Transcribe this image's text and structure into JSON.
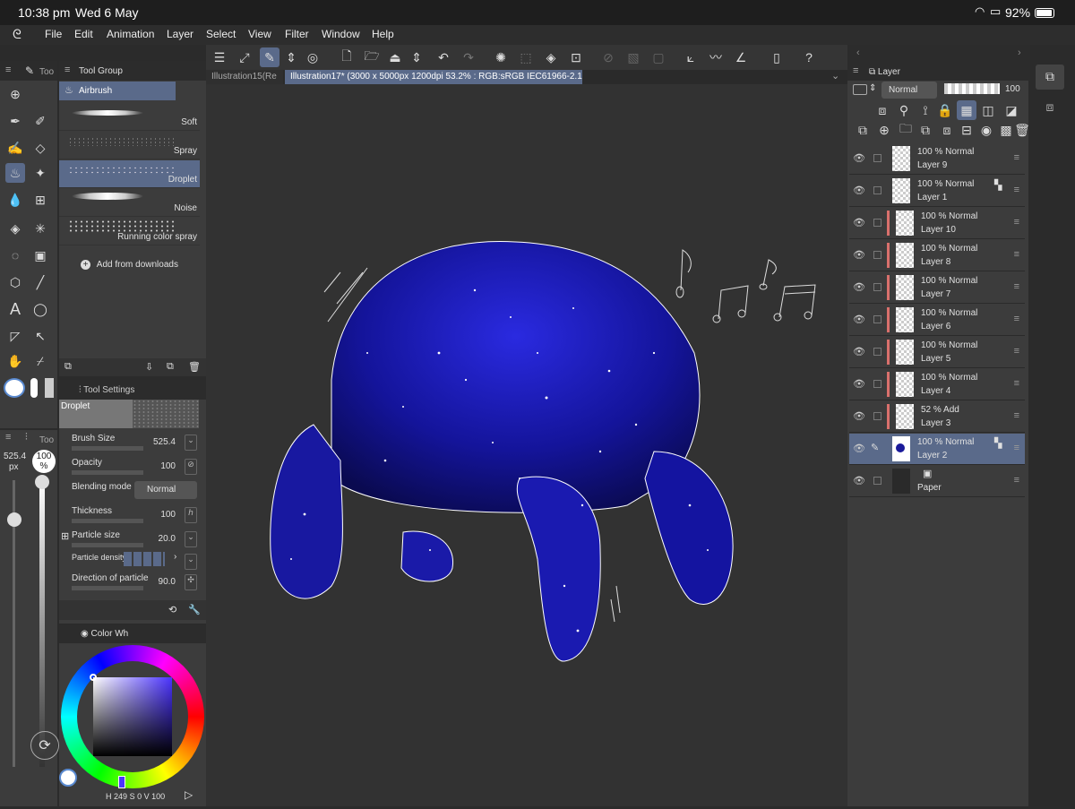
{
  "status": {
    "time": "10:38 pm",
    "date": "Wed 6 May",
    "battery": "92%"
  },
  "menu": [
    "File",
    "Edit",
    "Animation",
    "Layer",
    "Select",
    "View",
    "Filter",
    "Window",
    "Help"
  ],
  "tabs": [
    "Illustration15(Re",
    "Illustration17* (3000 x 5000px 1200dpi 53.2% : RGB:sRGB IEC61966-2.1)"
  ],
  "left": {
    "tool_tab": "Too",
    "tool_group_tab": "Tool Group",
    "size_px": "525.4",
    "size_unit": "px",
    "opacity": "100",
    "opacity_unit": "%",
    "left_tab2": "Too"
  },
  "tool_group": {
    "category": "Airbrush",
    "brushes": [
      "Soft",
      "Spray",
      "Droplet",
      "Noise",
      "Running color spray"
    ],
    "add": "Add from downloads"
  },
  "tool_settings": {
    "tab": "Tool Settings",
    "preset": "Droplet",
    "rows": [
      {
        "label": "Brush Size",
        "value": "525.4"
      },
      {
        "label": "Opacity",
        "value": "100"
      },
      {
        "label": "Blending mode",
        "value": "Normal"
      },
      {
        "label": "Thickness",
        "value": "100"
      },
      {
        "label": "Particle size",
        "value": "20.0"
      },
      {
        "label": "Particle density",
        "value": ""
      },
      {
        "label": "Direction of particle",
        "value": "90.0"
      }
    ]
  },
  "color": {
    "tab": "Color Wh",
    "h_label": "H",
    "h": "249",
    "s_label": "S",
    "s": "0",
    "v_label": "V",
    "v": "100"
  },
  "layers_panel": {
    "tab": "Layer",
    "blend": "Normal",
    "opacity": "100"
  },
  "layers": [
    {
      "pct": "100 %",
      "mode": "Normal",
      "name": "Layer 9"
    },
    {
      "pct": "100 %",
      "mode": "Normal",
      "name": "Layer 1"
    },
    {
      "pct": "100 %",
      "mode": "Normal",
      "name": "Layer 10"
    },
    {
      "pct": "100 %",
      "mode": "Normal",
      "name": "Layer 8"
    },
    {
      "pct": "100 %",
      "mode": "Normal",
      "name": "Layer 7"
    },
    {
      "pct": "100 %",
      "mode": "Normal",
      "name": "Layer 6"
    },
    {
      "pct": "100 %",
      "mode": "Normal",
      "name": "Layer 5"
    },
    {
      "pct": "100 %",
      "mode": "Normal",
      "name": "Layer 4"
    },
    {
      "pct": "52 %",
      "mode": "Add",
      "name": "Layer 3"
    },
    {
      "pct": "100 %",
      "mode": "Normal",
      "name": "Layer 2"
    },
    {
      "pct": "",
      "mode": "",
      "name": "Paper"
    }
  ],
  "colors": {
    "accent": "#5a6a8a",
    "layer_mark": "#d9706c",
    "galaxy": "#1a1a9a"
  }
}
